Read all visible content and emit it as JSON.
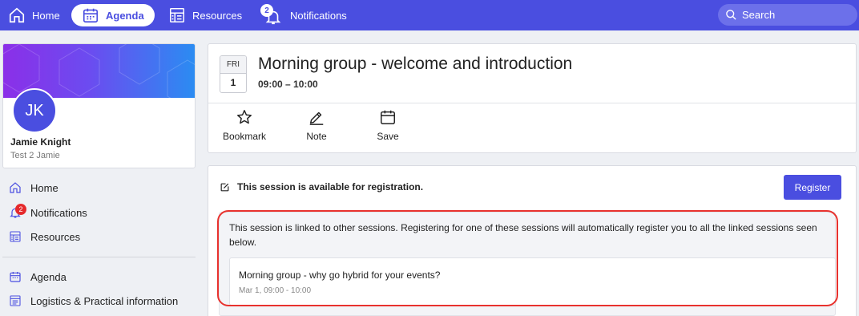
{
  "topnav": {
    "home": "Home",
    "agenda": "Agenda",
    "resources": "Resources",
    "notifications": "Notifications",
    "notifications_count": "2",
    "search_placeholder": "Search"
  },
  "profile": {
    "initials": "JK",
    "name": "Jamie Knight",
    "subtitle": "Test 2 Jamie"
  },
  "sidebar": {
    "items": [
      {
        "label": "Home",
        "icon": "home-icon"
      },
      {
        "label": "Notifications",
        "icon": "bell-icon",
        "badge": "2"
      },
      {
        "label": "Resources",
        "icon": "resources-icon"
      },
      {
        "label": "Agenda",
        "icon": "calendar-icon"
      },
      {
        "label": "Logistics & Practical information",
        "icon": "list-icon"
      }
    ]
  },
  "session": {
    "day_of_week": "FRI",
    "day": "1",
    "title": "Morning group - welcome and introduction",
    "time": "09:00 – 10:00",
    "actions": {
      "bookmark": "Bookmark",
      "note": "Note",
      "save": "Save"
    }
  },
  "registration": {
    "status": "This session is available for registration.",
    "button": "Register",
    "linked_text": "This session is linked to other sessions. Registering for one of these sessions will automatically register you to all the linked sessions seen below.",
    "linked_session": {
      "title": "Morning group - why go hybrid for your events?",
      "time": "Mar 1, 09:00 - 10:00"
    }
  },
  "colors": {
    "accent": "#4a4ee0",
    "highlight": "#e8322e",
    "badge": "#e5292b"
  }
}
